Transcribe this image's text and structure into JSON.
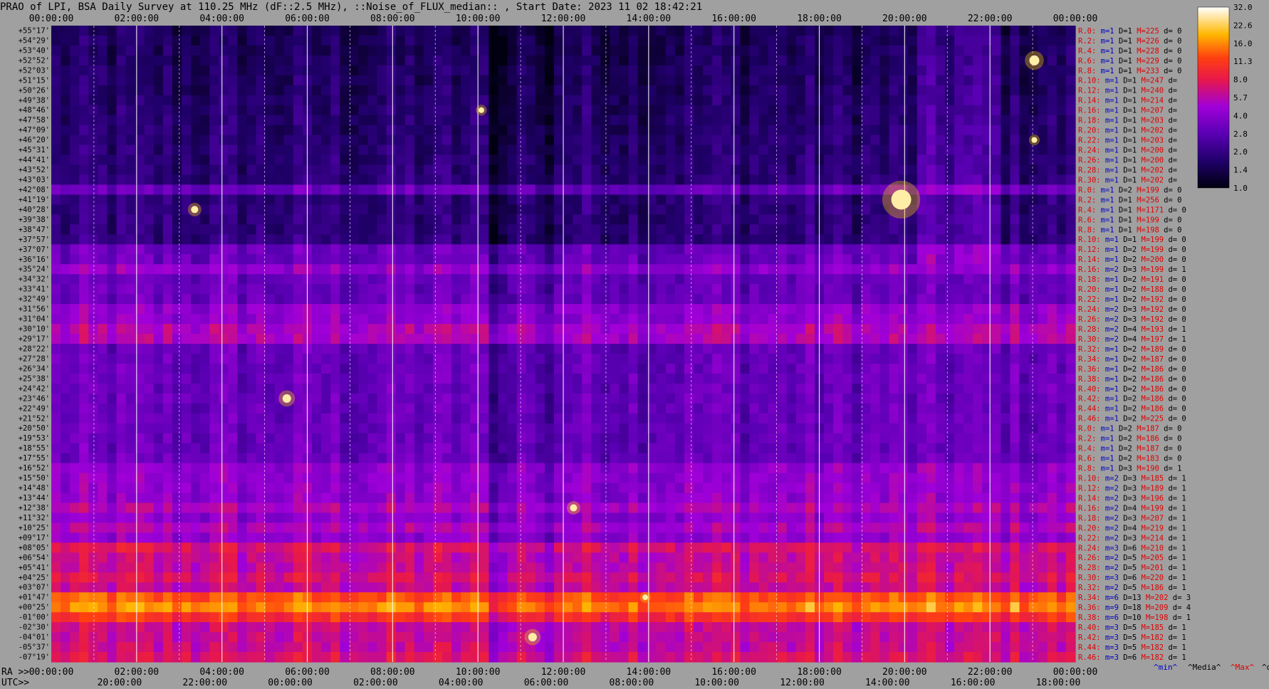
{
  "header": {
    "title": "PRAO of LPI, BSA Daily Survey at 110.25 MHz (dF::2.5 MHz), ::Noise_of_FLUX_median:: , Start Date: 2023 11 02 18:42:21"
  },
  "chart_data": {
    "type": "heatmap",
    "title": "PRAO of LPI, BSA Daily Survey at 110.25 MHz (dF::2.5 MHz), ::Noise_of_FLUX_median:: , Start Date: 2023 11 02 18:42:21",
    "x_top_ticks": [
      "00:00:00",
      "02:00:00",
      "04:00:00",
      "06:00:00",
      "08:00:00",
      "10:00:00",
      "12:00:00",
      "14:00:00",
      "16:00:00",
      "18:00:00",
      "20:00:00",
      "22:00:00",
      "00:00:00"
    ],
    "x_bottom_ra_label": "RA >>",
    "x_bottom_ra_ticks": [
      "00:00:00",
      "02:00:00",
      "04:00:00",
      "06:00:00",
      "08:00:00",
      "10:00:00",
      "12:00:00",
      "14:00:00",
      "16:00:00",
      "18:00:00",
      "20:00:00",
      "22:00:00",
      "00:00:00"
    ],
    "x_bottom_utc_label": "UTC>>",
    "x_bottom_utc_ticks": [
      "20:00:00",
      "22:00:00",
      "00:00:00",
      "02:00:00",
      "04:00:00",
      "06:00:00",
      "08:00:00",
      "10:00:00",
      "12:00:00",
      "14:00:00",
      "16:00:00",
      "18:00:00"
    ],
    "y_ticks": [
      "+55°17'",
      "+54°29'",
      "+53°40'",
      "+52°52'",
      "+52°03'",
      "+51°15'",
      "+50°26'",
      "+49°38'",
      "+48°46'",
      "+47°58'",
      "+47°09'",
      "+46°20'",
      "+45°31'",
      "+44°41'",
      "+43°52'",
      "+43°03'",
      "+42°08'",
      "+41°19'",
      "+40°28'",
      "+39°38'",
      "+38°47'",
      "+37°57'",
      "+37°07'",
      "+36°16'",
      "+35°24'",
      "+34°32'",
      "+33°41'",
      "+32°49'",
      "+31°56'",
      "+31°04'",
      "+30°10'",
      "+29°17'",
      "+28°22'",
      "+27°28'",
      "+26°34'",
      "+25°38'",
      "+24°42'",
      "+23°46'",
      "+22°49'",
      "+21°52'",
      "+20°50'",
      "+19°53'",
      "+18°55'",
      "+17°55'",
      "+16°52'",
      "+15°50'",
      "+14°48'",
      "+13°44'",
      "+12°38'",
      "+11°32'",
      "+10°25'",
      "+09°17'",
      "+08°05'",
      "+06°54'",
      "+05°41'",
      "+04°25'",
      "+03°07'",
      "+01°47'",
      "+00°25'",
      "-01°00'",
      "-02°30'",
      "-04°01'",
      "-05°37'",
      "-07°19'"
    ],
    "colorbar": {
      "ticks": [
        "32.0",
        "22.6",
        "16.0",
        "11.3",
        "8.0",
        "5.7",
        "4.0",
        "2.8",
        "2.0",
        "1.4",
        "1.0"
      ],
      "scale": "log",
      "range": [
        1.0,
        32.0
      ]
    },
    "stats": [
      {
        "R": "R.0:",
        "m": "m=1",
        "D": "D=1",
        "M": "M=225",
        "d": "d= 0"
      },
      {
        "R": "R.2:",
        "m": "m=1",
        "D": "D=1",
        "M": "M=226",
        "d": "d= 0"
      },
      {
        "R": "R.4:",
        "m": "m=1",
        "D": "D=1",
        "M": "M=228",
        "d": "d= 0"
      },
      {
        "R": "R.6:",
        "m": "m=1",
        "D": "D=1",
        "M": "M=229",
        "d": "d= 0"
      },
      {
        "R": "R.8:",
        "m": "m=1",
        "D": "D=1",
        "M": "M=233",
        "d": "d= 0"
      },
      {
        "R": "R.10:",
        "m": "m=1",
        "D": "D=1",
        "M": "M=247",
        "d": "d="
      },
      {
        "R": "R.12:",
        "m": "m=1",
        "D": "D=1",
        "M": "M=240",
        "d": "d="
      },
      {
        "R": "R.14:",
        "m": "m=1",
        "D": "D=1",
        "M": "M=214",
        "d": "d="
      },
      {
        "R": "R.16:",
        "m": "m=1",
        "D": "D=1",
        "M": "M=207",
        "d": "d="
      },
      {
        "R": "R.18:",
        "m": "m=1",
        "D": "D=1",
        "M": "M=203",
        "d": "d="
      },
      {
        "R": "R.20:",
        "m": "m=1",
        "D": "D=1",
        "M": "M=202",
        "d": "d="
      },
      {
        "R": "R.22:",
        "m": "m=1",
        "D": "D=1",
        "M": "M=203",
        "d": "d="
      },
      {
        "R": "R.24:",
        "m": "m=1",
        "D": "D=1",
        "M": "M=200",
        "d": "d="
      },
      {
        "R": "R.26:",
        "m": "m=1",
        "D": "D=1",
        "M": "M=200",
        "d": "d="
      },
      {
        "R": "R.28:",
        "m": "m=1",
        "D": "D=1",
        "M": "M=202",
        "d": "d="
      },
      {
        "R": "R.30:",
        "m": "m=1",
        "D": "D=1",
        "M": "M=202",
        "d": "d="
      },
      {
        "R": "R.0:",
        "m": "m=1",
        "D": "D=2",
        "M": "M=199",
        "d": "d= 0"
      },
      {
        "R": "R.2:",
        "m": "m=1",
        "D": "D=1",
        "M": "M=256",
        "d": "d= 0"
      },
      {
        "R": "R.4:",
        "m": "m=1",
        "D": "D=1",
        "M": "M=1171",
        "d": "d= 0"
      },
      {
        "R": "R.6:",
        "m": "m=1",
        "D": "D=1",
        "M": "M=199",
        "d": "d= 0"
      },
      {
        "R": "R.8:",
        "m": "m=1",
        "D": "D=1",
        "M": "M=198",
        "d": "d= 0"
      },
      {
        "R": "R.10:",
        "m": "m=1",
        "D": "D=1",
        "M": "M=199",
        "d": "d= 0"
      },
      {
        "R": "R.12:",
        "m": "m=1",
        "D": "D=2",
        "M": "M=199",
        "d": "d= 0"
      },
      {
        "R": "R.14:",
        "m": "m=1",
        "D": "D=2",
        "M": "M=200",
        "d": "d= 0"
      },
      {
        "R": "R.16:",
        "m": "m=2",
        "D": "D=3",
        "M": "M=199",
        "d": "d= 1"
      },
      {
        "R": "R.18:",
        "m": "m=1",
        "D": "D=2",
        "M": "M=191",
        "d": "d= 0"
      },
      {
        "R": "R.20:",
        "m": "m=1",
        "D": "D=2",
        "M": "M=188",
        "d": "d= 0"
      },
      {
        "R": "R.22:",
        "m": "m=1",
        "D": "D=2",
        "M": "M=192",
        "d": "d= 0"
      },
      {
        "R": "R.24:",
        "m": "m=2",
        "D": "D=3",
        "M": "M=192",
        "d": "d= 0"
      },
      {
        "R": "R.26:",
        "m": "m=2",
        "D": "D=3",
        "M": "M=192",
        "d": "d= 0"
      },
      {
        "R": "R.28:",
        "m": "m=2",
        "D": "D=4",
        "M": "M=193",
        "d": "d= 1"
      },
      {
        "R": "R.30:",
        "m": "m=2",
        "D": "D=4",
        "M": "M=197",
        "d": "d= 1"
      },
      {
        "R": "R.32:",
        "m": "m=1",
        "D": "D=2",
        "M": "M=189",
        "d": "d= 0"
      },
      {
        "R": "R.34:",
        "m": "m=1",
        "D": "D=2",
        "M": "M=187",
        "d": "d= 0"
      },
      {
        "R": "R.36:",
        "m": "m=1",
        "D": "D=2",
        "M": "M=186",
        "d": "d= 0"
      },
      {
        "R": "R.38:",
        "m": "m=1",
        "D": "D=2",
        "M": "M=186",
        "d": "d= 0"
      },
      {
        "R": "R.40:",
        "m": "m=1",
        "D": "D=2",
        "M": "M=186",
        "d": "d= 0"
      },
      {
        "R": "R.42:",
        "m": "m=1",
        "D": "D=2",
        "M": "M=186",
        "d": "d= 0"
      },
      {
        "R": "R.44:",
        "m": "m=1",
        "D": "D=2",
        "M": "M=186",
        "d": "d= 0"
      },
      {
        "R": "R.46:",
        "m": "m=1",
        "D": "D=2",
        "M": "M=225",
        "d": "d= 0"
      },
      {
        "R": "R.0:",
        "m": "m=1",
        "D": "D=2",
        "M": "M=187",
        "d": "d= 0"
      },
      {
        "R": "R.2:",
        "m": "m=1",
        "D": "D=2",
        "M": "M=186",
        "d": "d= 0"
      },
      {
        "R": "R.4:",
        "m": "m=1",
        "D": "D=2",
        "M": "M=187",
        "d": "d= 0"
      },
      {
        "R": "R.6:",
        "m": "m=1",
        "D": "D=2",
        "M": "M=183",
        "d": "d= 0"
      },
      {
        "R": "R.8:",
        "m": "m=1",
        "D": "D=3",
        "M": "M=190",
        "d": "d= 1"
      },
      {
        "R": "R.10:",
        "m": "m=2",
        "D": "D=3",
        "M": "M=185",
        "d": "d= 1"
      },
      {
        "R": "R.12:",
        "m": "m=2",
        "D": "D=3",
        "M": "M=189",
        "d": "d= 1"
      },
      {
        "R": "R.14:",
        "m": "m=2",
        "D": "D=3",
        "M": "M=196",
        "d": "d= 1"
      },
      {
        "R": "R.16:",
        "m": "m=2",
        "D": "D=4",
        "M": "M=199",
        "d": "d= 1"
      },
      {
        "R": "R.18:",
        "m": "m=2",
        "D": "D=3",
        "M": "M=207",
        "d": "d= 1"
      },
      {
        "R": "R.20:",
        "m": "m=2",
        "D": "D=4",
        "M": "M=219",
        "d": "d= 1"
      },
      {
        "R": "R.22:",
        "m": "m=2",
        "D": "D=3",
        "M": "M=214",
        "d": "d= 1"
      },
      {
        "R": "R.24:",
        "m": "m=3",
        "D": "D=6",
        "M": "M=210",
        "d": "d= 1"
      },
      {
        "R": "R.26:",
        "m": "m=2",
        "D": "D=5",
        "M": "M=205",
        "d": "d= 1"
      },
      {
        "R": "R.28:",
        "m": "m=2",
        "D": "D=5",
        "M": "M=201",
        "d": "d= 1"
      },
      {
        "R": "R.30:",
        "m": "m=3",
        "D": "D=6",
        "M": "M=220",
        "d": "d= 1"
      },
      {
        "R": "R.32:",
        "m": "m=2",
        "D": "D=5",
        "M": "M=186",
        "d": "d= 1"
      },
      {
        "R": "R.34:",
        "m": "m=6",
        "D": "D=13",
        "M": "M=202",
        "d": "d= 3"
      },
      {
        "R": "R.36:",
        "m": "m=9",
        "D": "D=18",
        "M": "M=209",
        "d": "d= 4"
      },
      {
        "R": "R.38:",
        "m": "m=6",
        "D": "D=10",
        "M": "M=198",
        "d": "d= 1"
      },
      {
        "R": "R.40:",
        "m": "m=3",
        "D": "D=5",
        "M": "M=185",
        "d": "d= 1"
      },
      {
        "R": "R.42:",
        "m": "m=3",
        "D": "D=5",
        "M": "M=182",
        "d": "d= 1"
      },
      {
        "R": "R.44:",
        "m": "m=3",
        "D": "D=5",
        "M": "M=182",
        "d": "d= 1"
      },
      {
        "R": "R.46:",
        "m": "m=3",
        "D": "D=6",
        "M": "M=182",
        "d": "d= 1"
      }
    ],
    "stats_legend": [
      "^min^",
      "^Media^",
      "^Max^",
      "^devia^"
    ],
    "colors": {
      "background": "#a0a0a0",
      "stat_red": "#e00000",
      "stat_blue": "#0000c0",
      "axis_text": "#000000",
      "side_numbers": "#c00000"
    }
  }
}
